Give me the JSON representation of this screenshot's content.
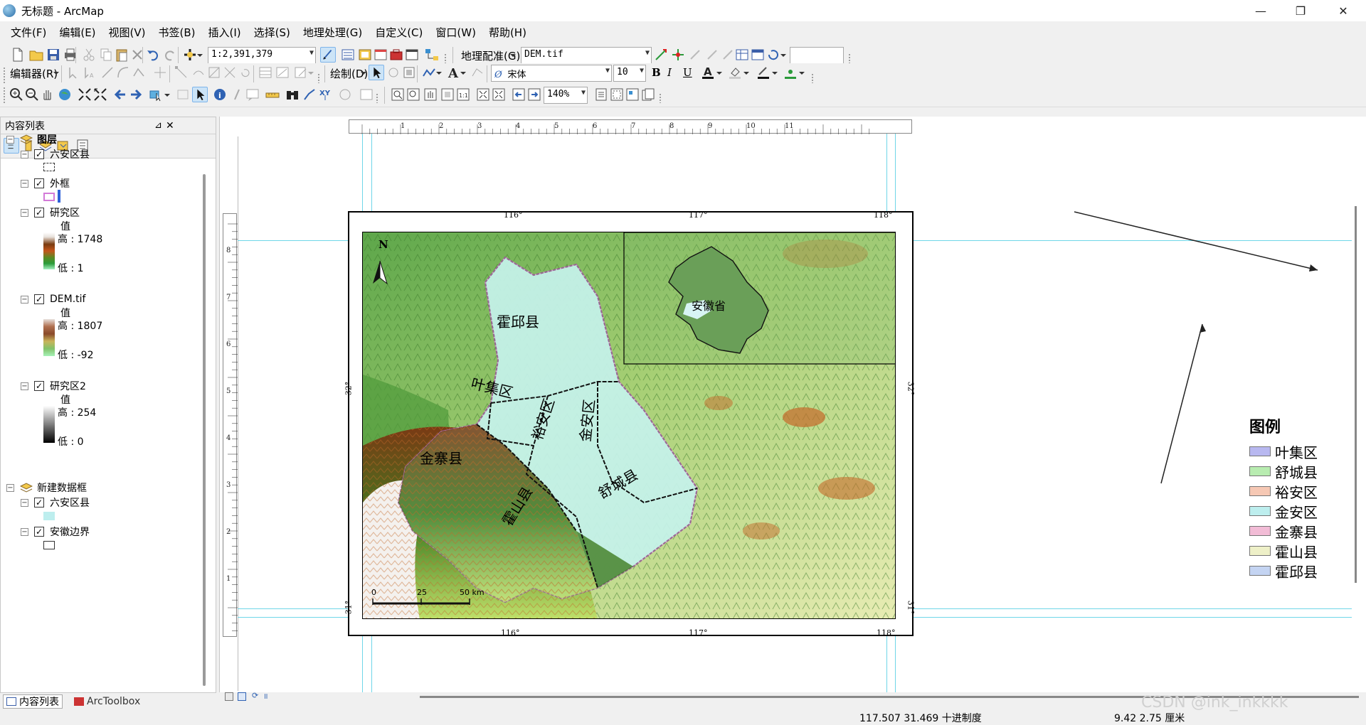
{
  "window": {
    "title": "无标题 - ArcMap",
    "minimize": "—",
    "maximize": "❐",
    "close": "✕"
  },
  "menu": [
    "文件(F)",
    "编辑(E)",
    "视图(V)",
    "书签(B)",
    "插入(I)",
    "选择(S)",
    "地理处理(G)",
    "自定义(C)",
    "窗口(W)",
    "帮助(H)"
  ],
  "toolbar": {
    "scale_value": "1:2,391,379",
    "georef_label": "地理配准(G)",
    "georef_layer": "DEM.tif",
    "editor_label": "编辑器(R)",
    "draw_label": "绘制(D)",
    "font_name": "宋体",
    "font_size": "10",
    "zoom_value": "140%",
    "bold": "B",
    "italic": "I",
    "underline": "U",
    "font_color": "A"
  },
  "toc": {
    "title": "内容列表",
    "pin": "ᵽ",
    "close": "✕",
    "frame1": "图层",
    "layers1": [
      {
        "name": "六安区县"
      },
      {
        "name": "外框"
      },
      {
        "name": "研究区",
        "value_label": "值",
        "high": "高 : 1748",
        "low": "低 : 1"
      },
      {
        "name": "DEM.tif",
        "value_label": "值",
        "high": "高 : 1807",
        "low": "低 : -92"
      },
      {
        "name": "研究区2",
        "value_label": "值",
        "high": "高 : 254",
        "low": "低 : 0"
      }
    ],
    "frame2": "新建数据框",
    "layers2": [
      {
        "name": "六安区县"
      },
      {
        "name": "安徽边界"
      }
    ],
    "tab1": "内容列表",
    "tab2": "ArcToolbox"
  },
  "map": {
    "north": "N",
    "top_ticks": [
      "116°",
      "117°",
      "118°"
    ],
    "bottom_ticks": [
      "116°",
      "117°",
      "118°"
    ],
    "side_lat": "32°",
    "side_lat_bottom": "31°",
    "counties": [
      "霍邱县",
      "叶集区",
      "裕安区",
      "金安区",
      "金寨县",
      "霍山县",
      "舒城县"
    ],
    "inset_label": "安徽省",
    "scalebar": [
      "0",
      "25",
      "50 km"
    ]
  },
  "ruler": {
    "top": [
      "1",
      "2",
      "3",
      "4",
      "5",
      "6",
      "7",
      "8",
      "9",
      "10",
      "11"
    ],
    "left": [
      "8",
      "7",
      "6",
      "5",
      "4",
      "3",
      "2",
      "1"
    ]
  },
  "legend": {
    "title": "图例",
    "items": [
      {
        "label": "叶集区",
        "color": "#b8b8f0"
      },
      {
        "label": "舒城县",
        "color": "#b8ecb0"
      },
      {
        "label": "裕安区",
        "color": "#f6c8b4"
      },
      {
        "label": "金安区",
        "color": "#bdeeee"
      },
      {
        "label": "金寨县",
        "color": "#f2bcd6"
      },
      {
        "label": "霍山县",
        "color": "#eef0c8"
      },
      {
        "label": "霍邱县",
        "color": "#c4d4f2"
      }
    ]
  },
  "status": {
    "coords": "117.507  31.469 十进制度",
    "page_coords": "9.42  2.75 厘米",
    "watermark": "CSDN @ink_inkkkk"
  }
}
